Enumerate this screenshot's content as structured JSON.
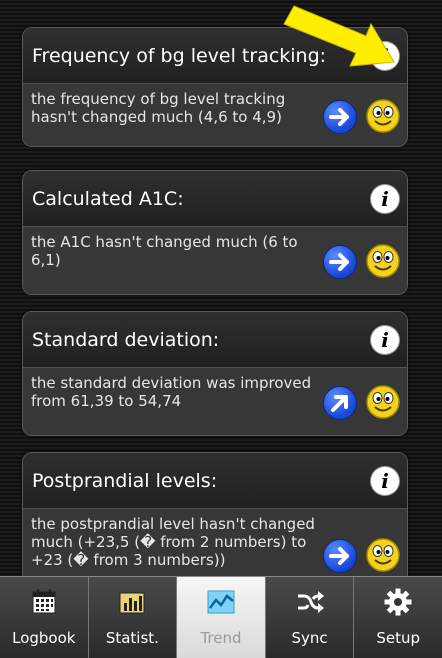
{
  "cards": [
    {
      "title": "Frequency of bg level tracking:",
      "text": "the frequency of bg level tracking hasn't changed much (4,6 to 4,9)",
      "trend": "right"
    },
    {
      "title": "Calculated A1C:",
      "text": "the A1C hasn't changed much (6 to 6,1)",
      "trend": "right"
    },
    {
      "title": "Standard deviation:",
      "text": "the standard deviation was improved from 61,39 to 54,74",
      "trend": "up-right"
    },
    {
      "title": "Postprandial levels:",
      "text": "the postprandial level hasn't changed much (+23,5 (� from 2 numbers) to +23 (� from 3 numbers))",
      "trend": "right"
    }
  ],
  "info_glyph": "i",
  "tabs": [
    {
      "label": "Logbook",
      "icon": "calendar-icon"
    },
    {
      "label": "Statist.",
      "icon": "bar-chart-icon"
    },
    {
      "label": "Trend",
      "icon": "trend-line-icon",
      "active": true
    },
    {
      "label": "Sync",
      "icon": "shuffle-icon"
    },
    {
      "label": "Setup",
      "icon": "gear-icon"
    }
  ],
  "colors": {
    "highlight_arrow": "#ffee00",
    "trend_arrow": "#1f57e8",
    "smiley": "#f2d21a"
  }
}
